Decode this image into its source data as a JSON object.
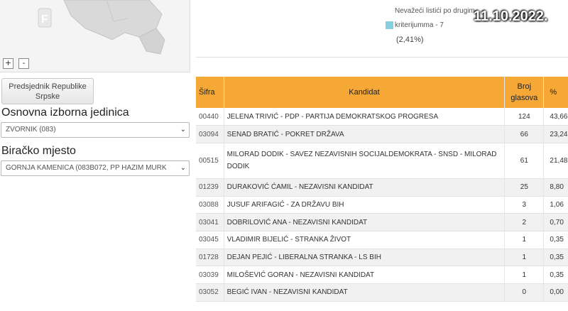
{
  "map": {
    "zoom_in": "+",
    "zoom_out": "-",
    "logo": "F"
  },
  "tab": {
    "label_line1": "Predsjednik Republike",
    "label_line2": "Srpske"
  },
  "unit": {
    "label": "Osnovna izborna jedinica",
    "selected": "ZVORNIK (083)"
  },
  "station": {
    "label": "Biračko mjesto",
    "selected": "GORNJA KAMENICA (083B072, PP HAZIM MURK"
  },
  "legend": {
    "title": "Nevažeći listići po drugim",
    "item": "kriterijumma - 7",
    "percent": "(2,41%)",
    "swatch_color": "#86cfe0"
  },
  "date_stamp": "11.10.2022.",
  "table": {
    "headers": {
      "code": "Šifra",
      "candidate": "Kandidat",
      "votes_line1": "Broj",
      "votes_line2": "glasova",
      "percent": "%"
    },
    "rows": [
      {
        "code": "00440",
        "name": "JELENA TRIVIĆ - PDP - PARTIJA DEMOKRATSKOG PROGRESA",
        "votes": "124",
        "pct": "43,66"
      },
      {
        "code": "03094",
        "name": "SENAD BRATIĆ - POKRET DRŽAVA",
        "votes": "66",
        "pct": "23,24"
      },
      {
        "code": "00515",
        "name": "MILORAD DODIK - SAVEZ NEZAVISNIH SOCIJALDEMOKRATA - SNSD - MILORAD DODIK",
        "votes": "61",
        "pct": "21,48"
      },
      {
        "code": "01239",
        "name": "DURAKOVIĆ ĆAMIL - NEZAVISNI KANDIDAT",
        "votes": "25",
        "pct": "8,80"
      },
      {
        "code": "03088",
        "name": "JUSUF ARIFAGIĆ - ZA DRŽAVU BIH",
        "votes": "3",
        "pct": "1,06"
      },
      {
        "code": "03041",
        "name": "DOBRILOVIĆ ANA - NEZAVISNI KANDIDAT",
        "votes": "2",
        "pct": "0,70"
      },
      {
        "code": "03045",
        "name": "VLADIMIR BIJELIĆ - STRANKA ŽIVOT",
        "votes": "1",
        "pct": "0,35"
      },
      {
        "code": "01728",
        "name": "DEJAN PEJIĆ - LIBERALNA STRANKA - LS BIH",
        "votes": "1",
        "pct": "0,35"
      },
      {
        "code": "03039",
        "name": "MILOŠEVIĆ GORAN - NEZAVISNI KANDIDAT",
        "votes": "1",
        "pct": "0,35"
      },
      {
        "code": "03052",
        "name": "BEGIĆ IVAN - NEZAVISNI KANDIDAT",
        "votes": "0",
        "pct": "0,00"
      }
    ]
  }
}
